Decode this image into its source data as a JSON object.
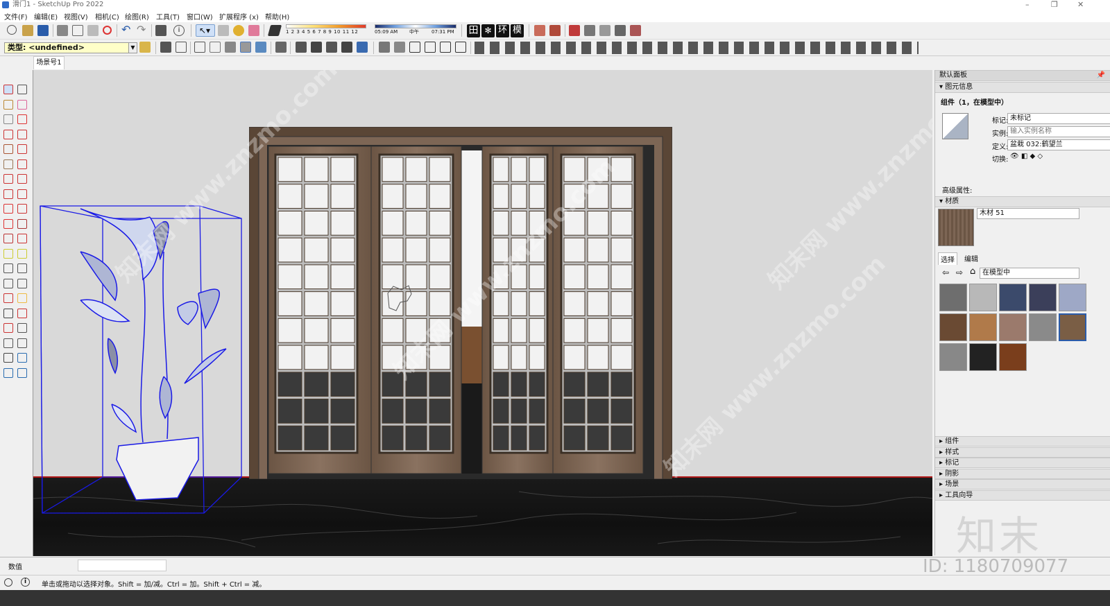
{
  "window": {
    "title": "滑门1 - SketchUp Pro 2022"
  },
  "menu": [
    "文件(F)",
    "编辑(E)",
    "视图(V)",
    "相机(C)",
    "绘图(R)",
    "工具(T)",
    "窗口(W)",
    "扩展程序 (x)",
    "帮助(H)"
  ],
  "shadow_bar": {
    "hours": "1 2 3 4 5 6 7 8 9 10 11 12",
    "time_start": "05:09 AM",
    "time_mid": "中午",
    "time_end": "07:31 PM"
  },
  "toolbar_text": {
    "env": "环",
    "mod": "模"
  },
  "type_selector": {
    "value": "类型: <undefined>"
  },
  "scene_tab": {
    "label": "场景号1"
  },
  "panel": {
    "title": "默认面板",
    "entity_info": {
      "header": "图元信息",
      "component_title": "组件（1，在模型中）",
      "tag_label": "标记:",
      "tag_value": "未标记",
      "instance_label": "实例:",
      "instance_placeholder": "输入实例名称",
      "definition_label": "定义:",
      "definition_value": "盆栽 032:鹤望兰",
      "toggle_label": "切换:",
      "advanced_label": "高级属性:"
    },
    "materials": {
      "header": "材质",
      "name": "木材 51",
      "tab_select": "选择",
      "tab_edit": "编辑",
      "library": "在模型中",
      "swatches": [
        "#6e6e6e",
        "#b8b8b8",
        "#3b4a6b",
        "#3b3f5a",
        "#9ea8c6",
        "#6a4a33",
        "#b07a4a",
        "#9b7a6c",
        "#8a8a8a",
        "#7a5e45",
        "#888888",
        "#222222",
        "#7a3e1c"
      ]
    },
    "trays": [
      "组件",
      "样式",
      "标记",
      "阴影",
      "场景",
      "工具向导"
    ]
  },
  "value_bar": {
    "label": "数值",
    "value": ""
  },
  "status": {
    "message": "单击或拖动以选择对象。Shift = 加/减。Ctrl = 加。Shift + Ctrl = 减。"
  },
  "watermark": {
    "logo": "知末",
    "id": "ID: 1180709077",
    "site": "知末网 www.znzmo.com"
  }
}
